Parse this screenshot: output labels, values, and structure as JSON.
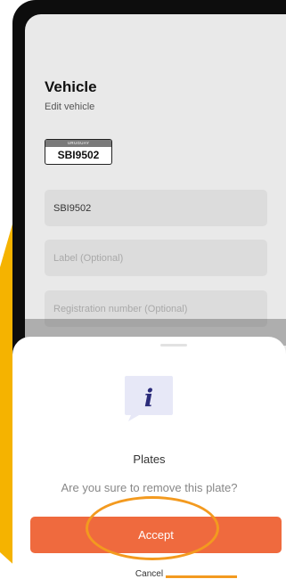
{
  "vehicle": {
    "title": "Vehicle",
    "subtitle": "Edit vehicle",
    "plate": {
      "country": "URUGUAY",
      "number": "SBI9502"
    },
    "fields": {
      "plate_value": "SBI9502",
      "label_placeholder": "Label (Optional)",
      "registration_placeholder": "Registration number (Optional)"
    }
  },
  "dialog": {
    "icon": "info-icon",
    "icon_glyph": "i",
    "title": "Plates",
    "message": "Are you sure to remove this plate?",
    "accept_label": "Accept",
    "cancel_label": "Cancel"
  },
  "colors": {
    "accent": "#ef6a3e",
    "highlight": "#f39a1f",
    "decor_yellow": "#f5b300",
    "icon_bg": "#e7e8f7",
    "icon_glyph": "#2b2b7a"
  }
}
